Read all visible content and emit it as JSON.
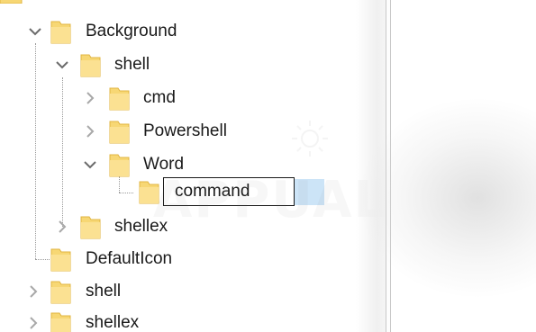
{
  "registry_tree": {
    "nodes": [
      {
        "label": "Background",
        "expanded": true
      },
      {
        "label": "shell",
        "expanded": true
      },
      {
        "label": "cmd",
        "expanded": false
      },
      {
        "label": "Powershell",
        "expanded": false
      },
      {
        "label": "Word",
        "expanded": true
      },
      {
        "label": "command",
        "editing": true
      },
      {
        "label": "shellex",
        "expanded": false
      },
      {
        "label": "DefaultIcon"
      },
      {
        "label": "shell",
        "expanded": false
      },
      {
        "label": "shellex",
        "expanded": false
      }
    ]
  },
  "rename_field": {
    "value": "command"
  },
  "watermark": {
    "text": "APPUALS"
  },
  "colors": {
    "folder_fill": "#f7d774",
    "folder_edge": "#e0b440",
    "selection": "#cce4f7",
    "chevron": "#6b6b6b"
  }
}
